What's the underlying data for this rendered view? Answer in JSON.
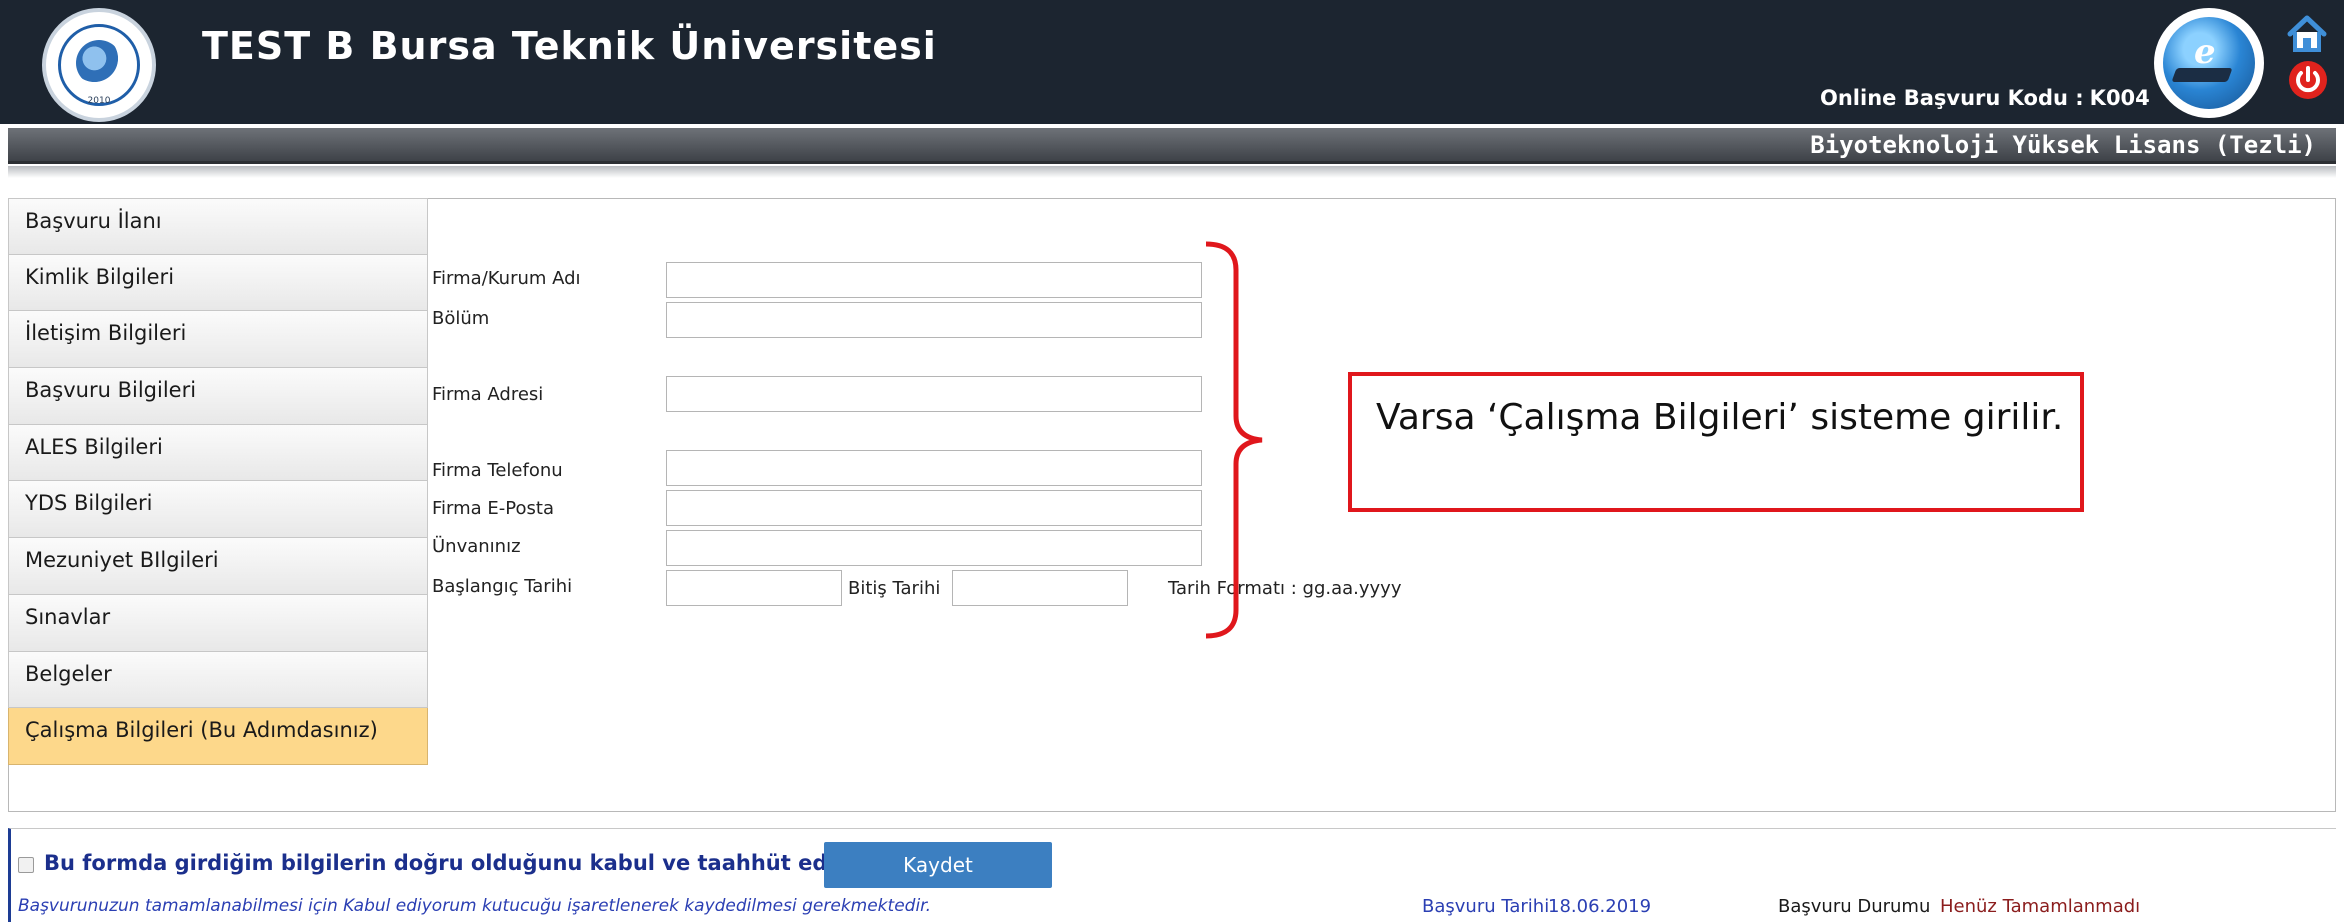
{
  "header": {
    "university_title": "TEST B Bursa Teknik Üniversitesi",
    "logo_year": "2010",
    "application_code_label": "Online Başvuru Kodu :",
    "application_code_value": "K004",
    "program_title": "Biyoteknoloji Yüksek Lisans (Tezli)",
    "icons": [
      "university-logo",
      "e-learning-icon",
      "home-icon",
      "power-icon"
    ]
  },
  "sidebar": {
    "items": [
      {
        "label": "Başvuru İlanı",
        "active": false
      },
      {
        "label": "Kimlik Bilgileri",
        "active": false
      },
      {
        "label": "İletişim Bilgileri",
        "active": false
      },
      {
        "label": "Başvuru Bilgileri",
        "active": false
      },
      {
        "label": "ALES Bilgileri",
        "active": false
      },
      {
        "label": "YDS Bilgileri",
        "active": false
      },
      {
        "label": "Mezuniyet BIlgileri",
        "active": false
      },
      {
        "label": "Sınavlar",
        "active": false
      },
      {
        "label": "Belgeler",
        "active": false
      },
      {
        "label": "Çalışma Bilgileri (Bu Adımdasınız)",
        "active": true
      }
    ]
  },
  "form": {
    "company_label": "Firma/Kurum Adı",
    "company_value": "",
    "department_label": "Bölüm",
    "department_value": "",
    "address_label": "Firma Adresi",
    "address_value": "",
    "phone_label": "Firma Telefonu",
    "phone_value": "",
    "email_label": "Firma E-Posta",
    "email_value": "",
    "title_label": "Ünvanınız",
    "title_value": "",
    "start_date_label": "Başlangıç Tarihi",
    "start_date_value": "",
    "end_date_label": "Bitiş Tarihi",
    "end_date_value": "",
    "date_format_note": "Tarih Formatı : gg.aa.yyyy"
  },
  "annotation": {
    "callout_text": "Varsa ‘Çalışma Bilgileri’ sisteme girilir.",
    "color": "#e0171c"
  },
  "footer": {
    "agree_checked": false,
    "agree_text": "Bu formda girdiğim bilgilerin doğru olduğunu kabul ve taahhüt ediyorum.",
    "save_label": "Kaydet",
    "note": "Başvurunuzun tamamlanabilmesi için Kabul ediyorum kutucuğu işaretlenerek kaydedilmesi gerekmektedir.",
    "application_date_label": "Başvuru Tarihi",
    "application_date_value": "18.06.2019",
    "application_status_label": "Başvuru Durumu",
    "application_status_value": "Henüz Tamamlanmadı"
  },
  "colors": {
    "header_bg": "#1c2530",
    "active_step": "#fdd88b",
    "save_button": "#3c7fc1",
    "link_blue": "#2b3fb3",
    "status_red": "#8b1d1d"
  }
}
